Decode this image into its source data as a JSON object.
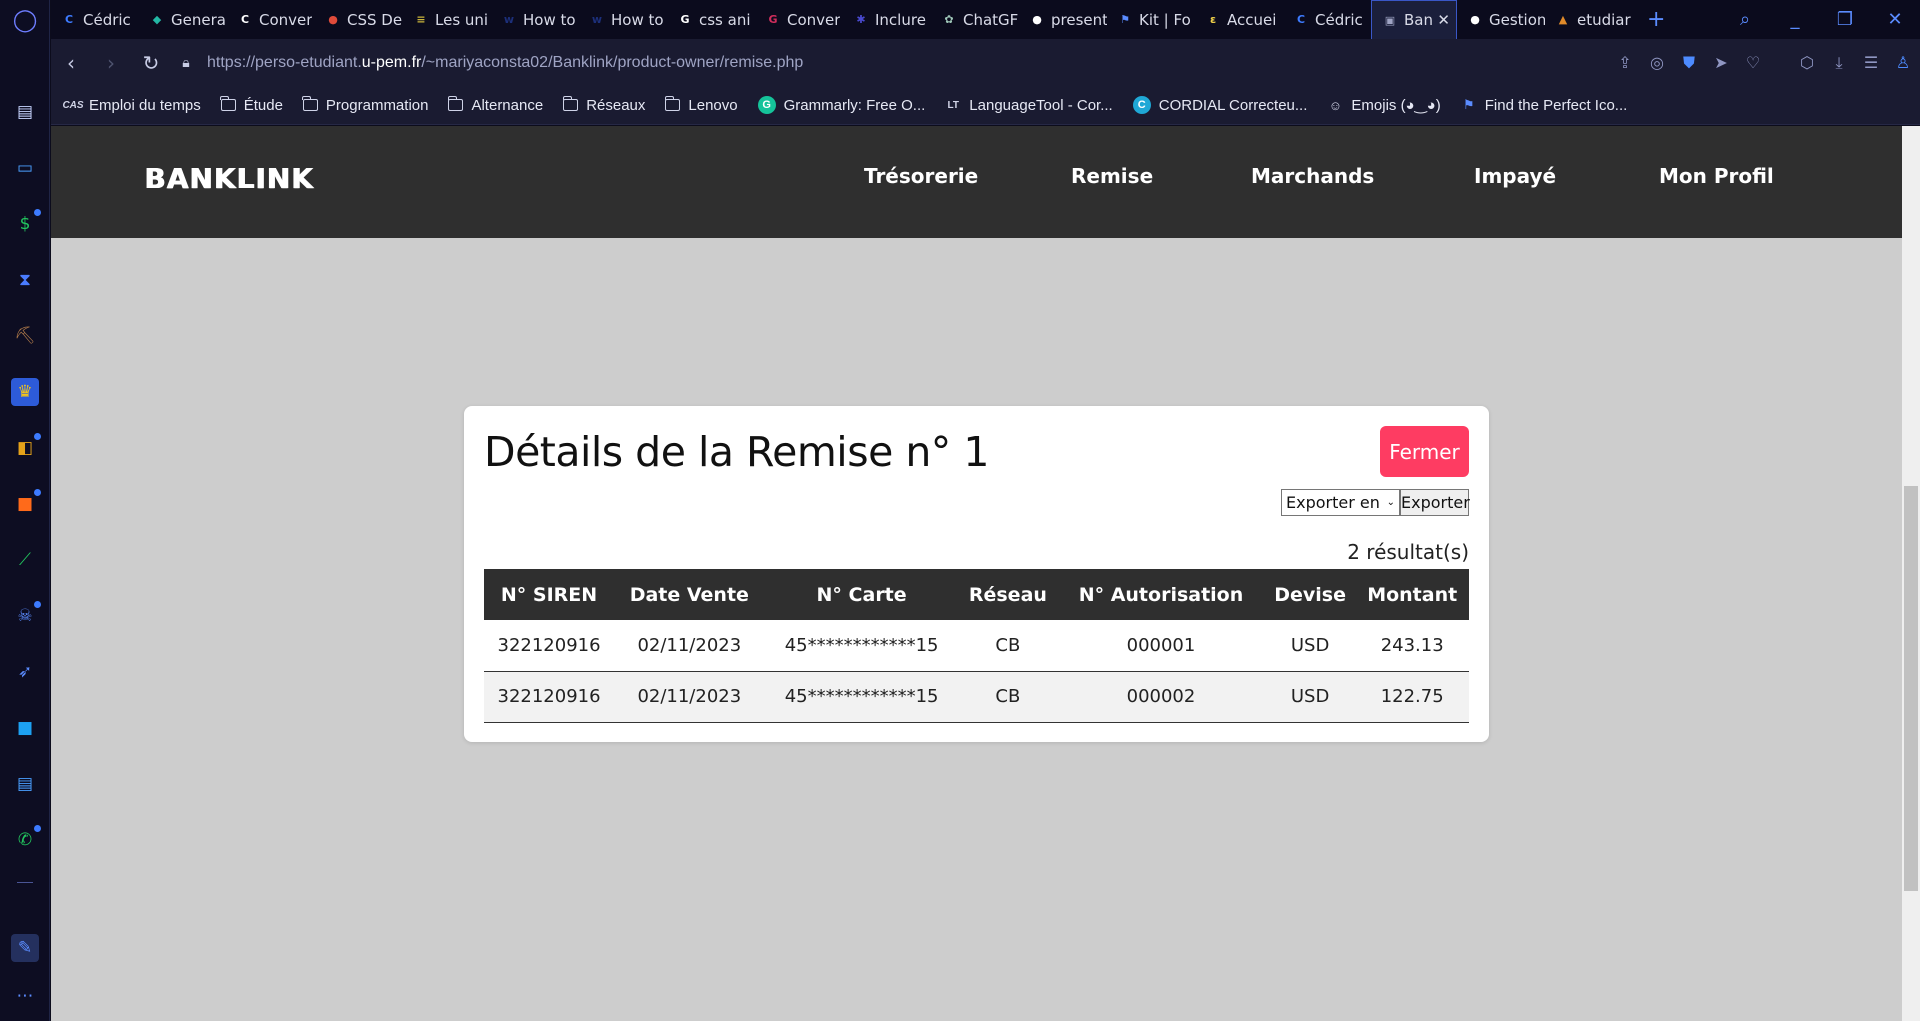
{
  "browser": {
    "tabs": [
      {
        "label": "Cédric",
        "icon": "C",
        "color": "#3d7bff"
      },
      {
        "label": "Genera",
        "icon": "◆",
        "color": "#23b8a5"
      },
      {
        "label": "Conver",
        "icon": "C",
        "color": "#ffffff"
      },
      {
        "label": "CSS De",
        "icon": "●",
        "color": "#e04b3a"
      },
      {
        "label": "Les uni",
        "icon": "≡",
        "color": "#c9b43c"
      },
      {
        "label": "How to",
        "icon": "w",
        "color": "#1c2f7a"
      },
      {
        "label": "How to",
        "icon": "w",
        "color": "#1c2f7a"
      },
      {
        "label": "css ani",
        "icon": "G",
        "color": "#ffffff"
      },
      {
        "label": "Conver",
        "icon": "G",
        "color": "#d02d5c"
      },
      {
        "label": "Inclure",
        "icon": "✱",
        "color": "#4a4ad0"
      },
      {
        "label": "ChatGF",
        "icon": "✿",
        "color": "#9ec6b8"
      },
      {
        "label": "present",
        "icon": "●",
        "color": "#ffffff"
      },
      {
        "label": "Kit | Fo",
        "icon": "⚑",
        "color": "#5b8cff"
      },
      {
        "label": "Accuei",
        "icon": "ε",
        "color": "#f2d24a"
      },
      {
        "label": "Cédric",
        "icon": "C",
        "color": "#3d7bff"
      },
      {
        "label": "Ban",
        "icon": "▣",
        "color": "#9fa4c4",
        "active": true
      },
      {
        "label": "Gestion",
        "icon": "●",
        "color": "#ffffff"
      },
      {
        "label": "etudiar",
        "icon": "▲",
        "color": "#e08a2a"
      }
    ],
    "url_prefix": "https://perso-etudiant.",
    "url_domain": "u-pem.fr",
    "url_path": "/~mariyaconsta02/Banklink/product-owner/remise.php",
    "bookmarks": [
      {
        "label": "Emploi du temps",
        "icon": "cas"
      },
      {
        "label": "Étude",
        "icon": "folder"
      },
      {
        "label": "Programmation",
        "icon": "folder"
      },
      {
        "label": "Alternance",
        "icon": "folder"
      },
      {
        "label": "Réseaux",
        "icon": "folder"
      },
      {
        "label": "Lenovo",
        "icon": "folder"
      },
      {
        "label": "Grammarly: Free O...",
        "icon": "grammarly"
      },
      {
        "label": "LanguageTool - Cor...",
        "icon": "languagetool"
      },
      {
        "label": "CORDIAL Correcteu...",
        "icon": "cordial"
      },
      {
        "label": "Emojis (◕‿◕)",
        "icon": "emoji"
      },
      {
        "label": "Find the Perfect Ico...",
        "icon": "flag"
      }
    ]
  },
  "site": {
    "logo": "BANKLINK",
    "nav": [
      "Trésorerie",
      "Remise",
      "Marchands",
      "Impayé",
      "Mon Profil"
    ]
  },
  "modal": {
    "title": "Détails de la Remise n° 1",
    "close_label": "Fermer",
    "export_select": "Exporter en",
    "export_button": "Exporter",
    "results": "2 résultat(s)",
    "columns": [
      "N° SIREN",
      "Date Vente",
      "N° Carte",
      "Réseau",
      "N° Autorisation",
      "Devise",
      "Montant"
    ],
    "rows": [
      [
        "322120916",
        "02/11/2023",
        "45************15",
        "CB",
        "000001",
        "USD",
        "243.13"
      ],
      [
        "322120916",
        "02/11/2023",
        "45************15",
        "CB",
        "000002",
        "USD",
        "122.75"
      ]
    ]
  },
  "colors": {
    "header_bg": "#2f2f2f",
    "page_bg": "#cdcdcd",
    "close_button": "#fe3c62"
  }
}
